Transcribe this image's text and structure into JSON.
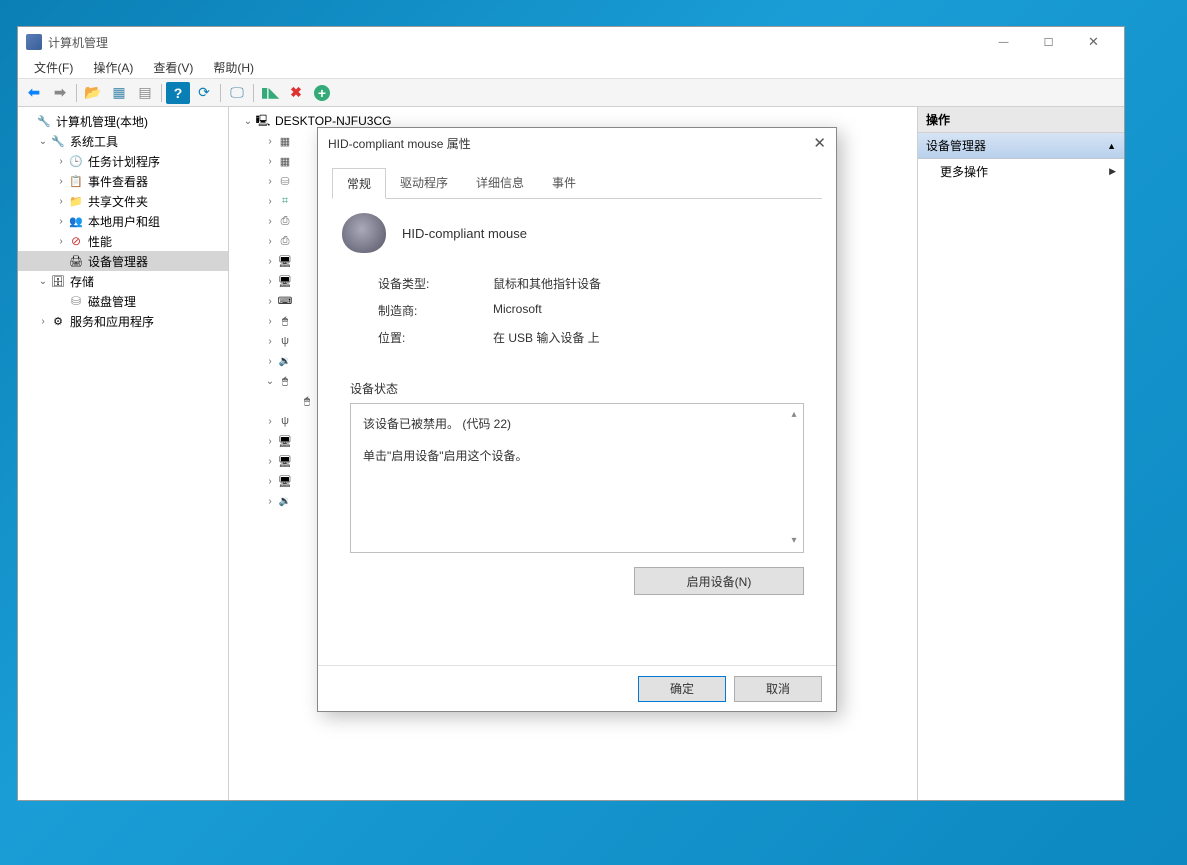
{
  "mainWindow": {
    "title": "计算机管理",
    "menus": {
      "file": "文件(F)",
      "action": "操作(A)",
      "view": "查看(V)",
      "help": "帮助(H)"
    }
  },
  "leftTree": {
    "root": "计算机管理(本地)",
    "sysTools": "系统工具",
    "taskScheduler": "任务计划程序",
    "eventViewer": "事件查看器",
    "sharedFolders": "共享文件夹",
    "localUsers": "本地用户和组",
    "performance": "性能",
    "deviceManager": "设备管理器",
    "storage": "存储",
    "diskMgmt": "磁盘管理",
    "services": "服务和应用程序"
  },
  "deviceTree": {
    "root": "DESKTOP-NJFU3CG"
  },
  "rightPanel": {
    "header": "操作",
    "section": "设备管理器",
    "more": "更多操作"
  },
  "dialog": {
    "title": "HID-compliant mouse 属性",
    "tabs": {
      "general": "常规",
      "driver": "驱动程序",
      "details": "详细信息",
      "events": "事件"
    },
    "deviceName": "HID-compliant mouse",
    "rows": {
      "typeLabel": "设备类型:",
      "typeValue": "鼠标和其他指针设备",
      "mfgLabel": "制造商:",
      "mfgValue": "Microsoft",
      "locLabel": "位置:",
      "locValue": "在 USB 输入设备 上"
    },
    "statusLegend": "设备状态",
    "statusLine1": "该设备已被禁用。 (代码 22)",
    "statusLine2": "单击\"启用设备\"启用这个设备。",
    "enableBtn": "启用设备(N)",
    "ok": "确定",
    "cancel": "取消"
  }
}
